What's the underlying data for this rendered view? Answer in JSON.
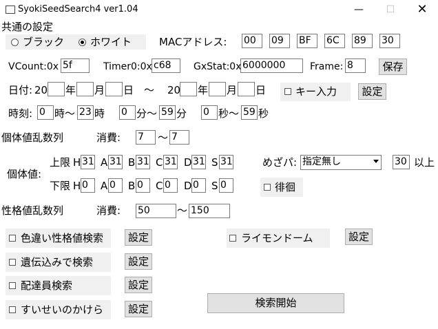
{
  "window": {
    "title": "SyokiSeedSearch4 ver1.04"
  },
  "common": {
    "heading": "共通の設定",
    "version_black": "ブラック",
    "version_white": "ホワイト",
    "mac_label": "MACアドレス:",
    "mac": [
      "00",
      "09",
      "BF",
      "6C",
      "89",
      "30"
    ],
    "vcount_label": "VCount:0x",
    "vcount": "5f",
    "timer0_label": "Timer0:0x",
    "timer0": "c68",
    "gxstat_label": "GxStat:0x",
    "gxstat": "6000000",
    "frame_label": "Frame:",
    "frame": "8",
    "save_label": "保存"
  },
  "date": {
    "label": "日付:",
    "from_year": "20",
    "from_year_unit": "年",
    "month_unit": "月",
    "day_unit": "日",
    "tilde": "～",
    "to_year": "20",
    "key_input_label": "キー入力",
    "settings_label": "設定"
  },
  "time": {
    "label": "時刻:",
    "hour_from": "0",
    "hour_to": "23",
    "hour_unit": "時",
    "min_from": "0",
    "min_to": "59",
    "min_unit": "分",
    "sec_from": "0",
    "sec_to": "59",
    "sec_unit": "秒",
    "tilde": "～"
  },
  "iv_seq": {
    "label": "個体値乱数列",
    "consume_label": "消費:",
    "from": "7",
    "tilde": "～",
    "to": "7"
  },
  "iv": {
    "label": "個体値:",
    "upper_label": "上限",
    "lower_label": "下限",
    "stats": [
      "H",
      "A",
      "B",
      "C",
      "D",
      "S"
    ],
    "upper": [
      "31",
      "31",
      "31",
      "31",
      "31",
      "31"
    ],
    "lower": [
      "0",
      "0",
      "0",
      "0",
      "0",
      "0"
    ]
  },
  "hidden_power": {
    "label": "めざパ:",
    "selected": "指定無し",
    "power": "30",
    "suffix": "以上"
  },
  "wander_label": "徘徊",
  "pid_seq": {
    "label": "性格値乱数列",
    "consume_label": "消費:",
    "from": "50",
    "tilde": "～",
    "to": "150"
  },
  "options": {
    "shiny_label": "色違い性格値検索",
    "egg_label": "遺伝込みで検索",
    "delivery_label": "配達員検索",
    "sleep_label": "すいせいのかけら",
    "settings_label": "設定",
    "raimon_label": "ライモンドーム"
  },
  "search_button": "検索開始"
}
